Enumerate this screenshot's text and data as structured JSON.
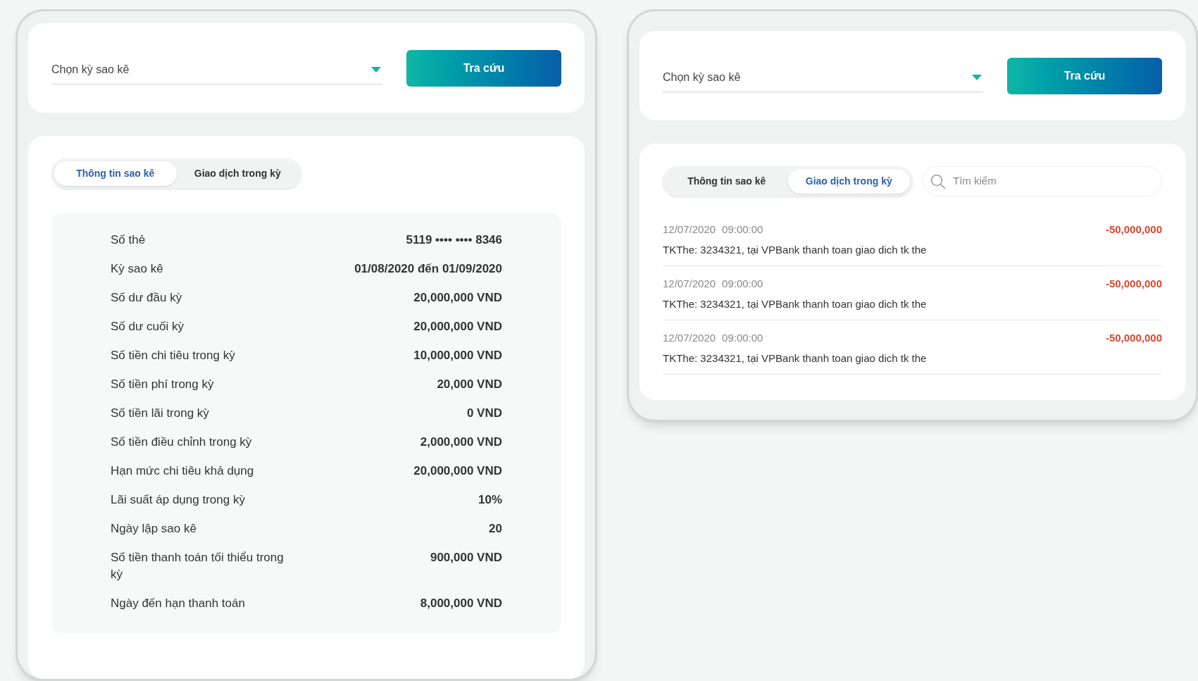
{
  "panels": [
    {
      "select": {
        "placeholder": "Chọn kỳ sao kê"
      },
      "button": "Tra cứu",
      "tabs": [
        {
          "label": "Thông tin sao kê",
          "selected": true
        },
        {
          "label": "Giao dịch trong kỳ",
          "selected": false
        }
      ],
      "details": [
        {
          "label": "Số thẻ",
          "value": "5119 •••• •••• 8346"
        },
        {
          "label": "Kỳ sao kê",
          "value": "01/08/2020 đến 01/09/2020"
        },
        {
          "label": "Số dư đầu kỳ",
          "value": "20,000,000 VND"
        },
        {
          "label": "Số dư cuối kỳ",
          "value": "20,000,000 VND"
        },
        {
          "label": "Số tiền chi tiêu trong kỳ",
          "value": "10,000,000 VND"
        },
        {
          "label": "Số tiền phí trong kỳ",
          "value": "20,000 VND"
        },
        {
          "label": "Số tiền lãi trong kỳ",
          "value": "0 VND"
        },
        {
          "label": "Số tiền điều chỉnh trong kỳ",
          "value": "2,000,000 VND"
        },
        {
          "label": "Hạn mức chi tiêu khả dụng",
          "value": "20,000,000 VND"
        },
        {
          "label": "Lãi suất áp dụng trong kỳ",
          "value": "10%"
        },
        {
          "label": "Ngày lập sao kê",
          "value": "20"
        },
        {
          "label": "Số tiền thanh toán tối thiểu trong kỳ",
          "value": "900,000 VND"
        },
        {
          "label": "Ngày đến hạn thanh toán",
          "value": "8,000,000 VND"
        }
      ]
    },
    {
      "select": {
        "placeholder": "Chọn kỳ sao kê"
      },
      "button": "Tra cứu",
      "tabs": [
        {
          "label": "Thông tin sao kê",
          "selected": false
        },
        {
          "label": "Giao dịch trong kỳ",
          "selected": true
        }
      ],
      "search": {
        "placeholder": "Tìm kiếm"
      },
      "transactions": [
        {
          "date": "12/07/2020",
          "time": "09:00:00",
          "description": "TKThe: 3234321, tại VPBank thanh toan giao dich tk the",
          "amount": "-50,000,000"
        },
        {
          "date": "12/07/2020",
          "time": "09:00:00",
          "description": "TKThe: 3234321, tại VPBank thanh toan giao dich tk the",
          "amount": "-50,000,000"
        },
        {
          "date": "12/07/2020",
          "time": "09:00:00",
          "description": "TKThe: 3234321, tại VPBank thanh toan giao dich tk the",
          "amount": "-50,000,000"
        }
      ]
    }
  ]
}
